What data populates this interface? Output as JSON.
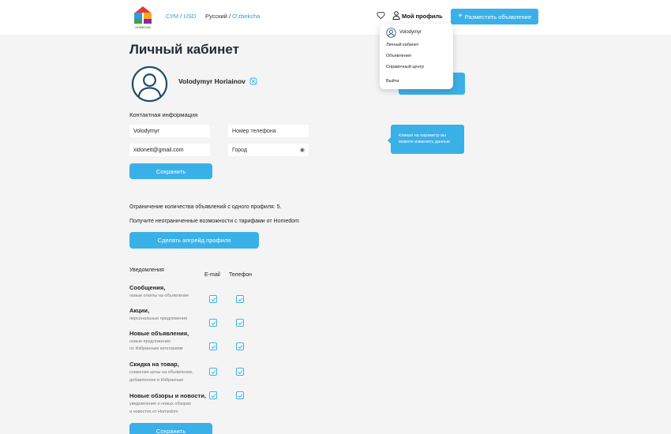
{
  "header": {
    "currency_a": "СУМ",
    "currency_sep": "/",
    "currency_b": "USD",
    "lang_a": "Русский",
    "lang_sep": "/",
    "lang_b": "O'zbekcha",
    "profile_label": "Мой профиль",
    "post_button": "Разместить объявление",
    "logo_text": "HOMEDOM"
  },
  "page": {
    "title": "Личный кабинет",
    "user_name": "Volodymyr Horiainov"
  },
  "contact": {
    "label": "Контактная информация",
    "first_name": "Volodymyr",
    "phone_placeholder": "Номер телефона",
    "email": "xidonett@gmail.com",
    "city_placeholder": "Город",
    "save_button": "Сохранить"
  },
  "tooltip": {
    "text": "Кликая на параметр вы можете изменить данные"
  },
  "dropdown": {
    "user": "Volodymyr",
    "items": [
      "Личный кабинет",
      "Объявления",
      "Справочный центр"
    ],
    "logout": "Выйти"
  },
  "limits": {
    "limit_text": "Ограничение количества объявлений с одного профиля: 5.",
    "promo_text": "Получите неограниченные возможности с тарифами от Homedom",
    "upgrade_button": "Сделать апгрейд профиля"
  },
  "notifications": {
    "heading": "Уведомления",
    "col_email": "E-mail",
    "col_phone": "Телефон",
    "rows": [
      {
        "title": "Сообщения,",
        "sub1": "новые ответы на объявление",
        "sub2": "",
        "email": true,
        "phone": true
      },
      {
        "title": "Акции,",
        "sub1": "персональные предложения",
        "sub2": "",
        "email": true,
        "phone": true
      },
      {
        "title": "Новые объявления,",
        "sub1": "новые предложения",
        "sub2": "по Избранным категориям",
        "email": true,
        "phone": true
      },
      {
        "title": "Скидка на товар,",
        "sub1": "снижение цены на объявление,",
        "sub2": "добавленное в Избранные",
        "email": true,
        "phone": true
      },
      {
        "title": "Новые обзоры и новости,",
        "sub1": "уведомление о новых обзорах",
        "sub2": "и новостях от Homedom",
        "email": true,
        "phone": true
      }
    ],
    "save_button": "Сохранить"
  },
  "colors": {
    "accent": "#3ab0e8",
    "background": "#f4f4f5",
    "title": "#1f2b33"
  }
}
